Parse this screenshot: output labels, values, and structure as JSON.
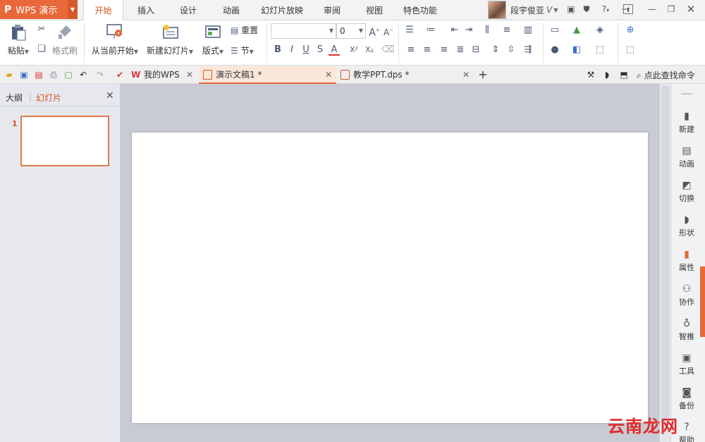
{
  "app": {
    "name": "WPS 演示",
    "logo": "P"
  },
  "menu_tabs": [
    "开始",
    "插入",
    "设计",
    "动画",
    "幻灯片放映",
    "审阅",
    "视图",
    "特色功能"
  ],
  "user": {
    "name": "段宇俊亚",
    "badge": "V"
  },
  "ribbon": {
    "paste": "粘贴",
    "format_painter": "格式刷",
    "from_current": "从当前开始",
    "new_slide": "新建幻灯片",
    "layout": "版式",
    "reset": "重置",
    "section": "节",
    "font_size": "0",
    "bold": "B",
    "italic": "I",
    "underline": "U",
    "strike": "S",
    "fontcolor": "A",
    "superscript": "X²",
    "subscript": "X₂"
  },
  "doc_tabs": [
    {
      "label": "我的WPS"
    },
    {
      "label": "演示文稿1 *"
    },
    {
      "label": "教学PPT.dps *"
    }
  ],
  "search": {
    "label": "点此查找命令"
  },
  "left_pane": {
    "tab_outline": "大纲",
    "tab_slides": "幻灯片",
    "slide_number": "1"
  },
  "right_sidebar": [
    "新建",
    "动画",
    "切换",
    "形状",
    "属性",
    "协作",
    "智推",
    "工具",
    "备份",
    "帮助"
  ],
  "watermark": "云南龙网",
  "colors": {
    "accent": "#e8683a",
    "active_tab_text": "#d9531e"
  }
}
